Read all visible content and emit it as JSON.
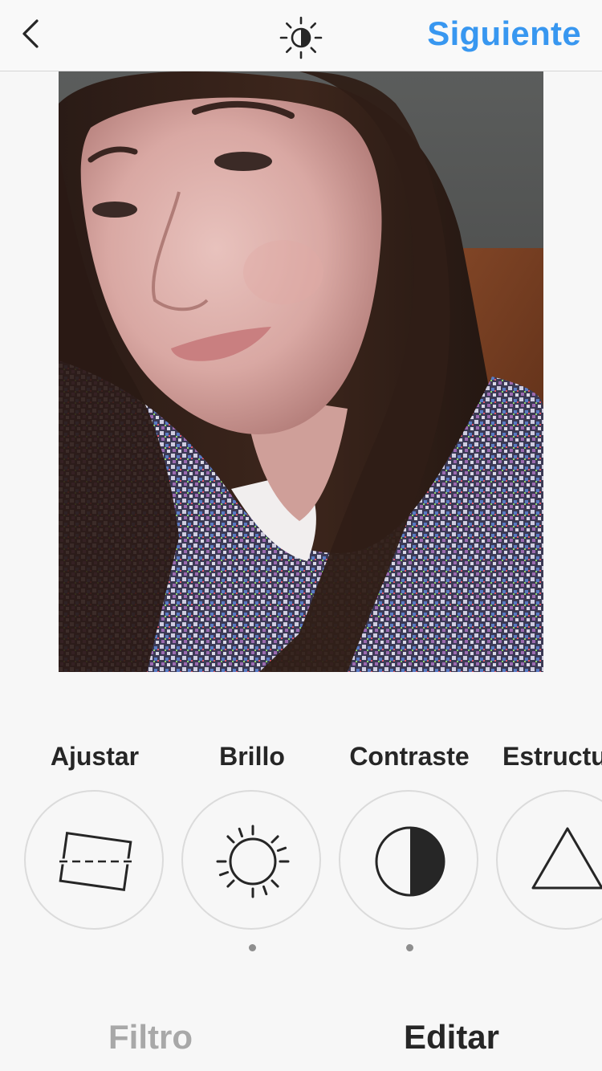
{
  "header": {
    "next_label": "Siguiente",
    "back_icon": "chevron-left-icon",
    "lux_icon": "lux-brightness-icon",
    "accent_color": "#3897f0"
  },
  "photo": {
    "subject": "selfie"
  },
  "tools": [
    {
      "label": "Ajustar",
      "icon": "adjust-icon",
      "has_dot": false
    },
    {
      "label": "Brillo",
      "icon": "brightness-icon",
      "has_dot": true
    },
    {
      "label": "Contraste",
      "icon": "contrast-icon",
      "has_dot": true
    },
    {
      "label": "Estructura",
      "icon": "structure-icon",
      "has_dot": false
    }
  ],
  "tabs": {
    "filter_label": "Filtro",
    "edit_label": "Editar",
    "active": "Editar"
  }
}
